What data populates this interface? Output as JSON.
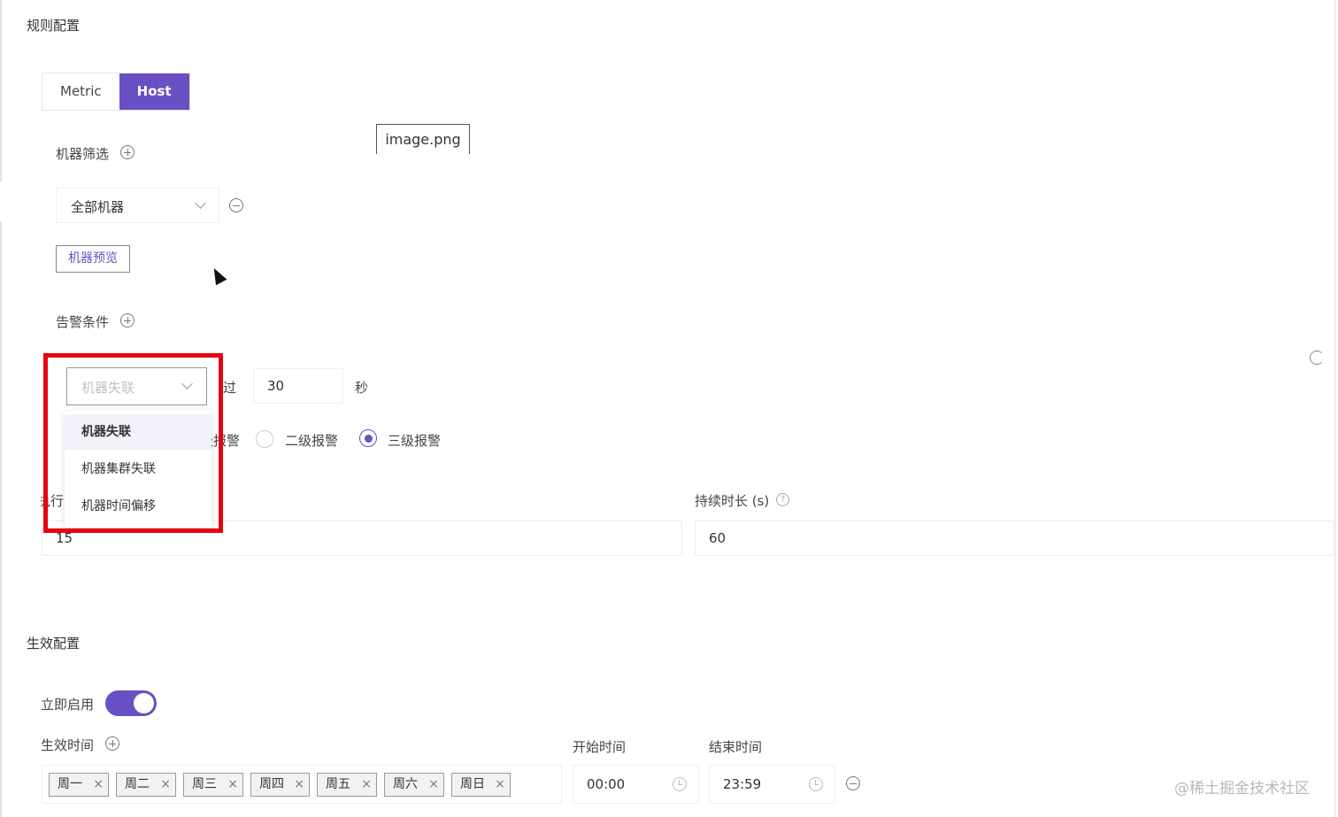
{
  "rule_config": {
    "title": "规则配置",
    "tabs": [
      {
        "label": "Metric"
      },
      {
        "label": "Host",
        "active": true
      }
    ],
    "tooltip": "image.png",
    "machine_filter": {
      "label": "机器筛选",
      "select_value": "全部机器",
      "preview_button": "机器预览"
    },
    "alert_condition": {
      "label": "告警条件",
      "condition_select_placeholder": "机器失联",
      "exceed_label": "超过",
      "exceed_label_partial": "超过",
      "exceed_value": "30",
      "unit": "秒",
      "dropdown_options": [
        "机器失联",
        "机器集群失联",
        "机器时间偏移"
      ],
      "alert_levels": [
        {
          "label": "一级报警",
          "partial": "一级报警"
        },
        {
          "label": "二级报警"
        },
        {
          "label": "三级报警",
          "checked": true
        }
      ],
      "exec_label_partial": "执行",
      "exec_value": "15",
      "duration_label": "持续时长 (s)",
      "duration_value": "60"
    }
  },
  "effective_config": {
    "title": "生效配置",
    "enable_label": "立即启用",
    "enable_on": true,
    "time_label": "生效时间",
    "days": [
      "周一",
      "周二",
      "周三",
      "周四",
      "周五",
      "周六",
      "周日"
    ],
    "start_time_label": "开始时间",
    "start_time": "00:00",
    "end_time_label": "结束时间",
    "end_time": "23:59"
  },
  "watermark": "@稀土掘金技术社区",
  "colors": {
    "accent": "#6a4fc4",
    "highlight_box": "#e60012"
  }
}
